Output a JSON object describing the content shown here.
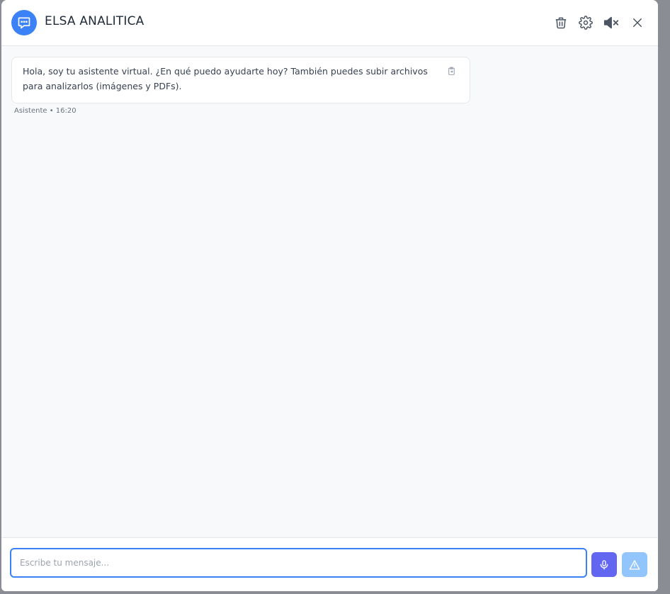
{
  "header": {
    "title": "ELSA ANALITICA",
    "icons": {
      "logo": "chat-bubble-icon",
      "delete": "trash-icon",
      "settings": "gear-icon",
      "sound": "speaker-muted-icon",
      "close": "close-icon"
    }
  },
  "messages": [
    {
      "text": "Hola, soy tu asistente virtual. ¿En qué puedo ayudarte hoy? También puedes subir archivos para analizarlos (imágenes y PDFs).",
      "meta": "Asistente • 16:20",
      "action_icon": "copy-icon"
    }
  ],
  "composer": {
    "placeholder": "Escribe tu mensaje...",
    "value": "",
    "mic_icon": "microphone-icon",
    "send_icon": "send-icon"
  },
  "colors": {
    "accent": "#3b82f6",
    "mic": "#6366f1",
    "send_disabled": "#93c5fd",
    "message_area": "#f8f9fb"
  }
}
